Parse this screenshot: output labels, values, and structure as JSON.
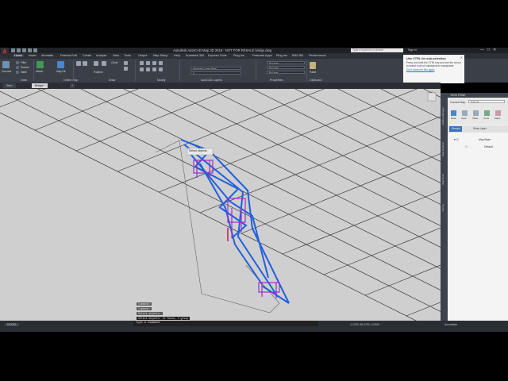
{
  "window": {
    "title": "Autodesk AutoCAD Map 3D 2016 - NOT FOR RESALE    bridge.dwg",
    "search_placeholder": "Type a keyword or phrase",
    "sign_in": "Sign In",
    "controls": [
      "—",
      "□",
      "✕"
    ]
  },
  "menu_tabs": [
    "Home",
    "Insert",
    "Annotate",
    "Feature Edit",
    "Create",
    "Analyze",
    "View",
    "Tools",
    "Output",
    "Map Setup",
    "Help",
    "Autodesk 360",
    "Express Tools",
    "Plug-ins",
    "Featured Apps",
    "Plug-ins",
    "BIM 360",
    "Performance"
  ],
  "ribbon": {
    "panels": [
      "Data",
      "Online Map",
      "Draw",
      "Modify",
      "AutoCAD Layers",
      "Properties",
      "Clipboard"
    ],
    "buttons": {
      "connect": "Connect",
      "filter": "Filter",
      "search": "Search",
      "table": "Table",
      "attach": "Attach",
      "map_dif": "Map Dif",
      "polyline": "Polyline",
      "circle": "Circle",
      "layer_state": "Unsaved Layer State",
      "layer_current": "0",
      "bylayer": [
        "ByLayer",
        "ByLayer",
        "ByLayer"
      ],
      "paste": "Paste"
    }
  },
  "tooltip": {
    "title": "Use CTRL for sub-selection",
    "body": "Press and hold the CTRL key and use the cursor to select a set of subobjects to manipulate.",
    "link": "Don't show me this again",
    "close": "✕"
  },
  "doc_tabs": [
    "Start",
    "Bridge*"
  ],
  "command": {
    "history": [
      "Command:",
      "Command:",
      "Select objects:",
      "Select objects: 12 found, 1 group"
    ],
    "input": "Type a command",
    "cursor_tip": "Select objects:"
  },
  "taskpane": {
    "header": "TASK PANE",
    "current_map_label": "Current Map:",
    "current_map": "Default",
    "tools": [
      "Data",
      "Style",
      "Table",
      "Tools",
      "Maps"
    ],
    "groups_label": "Groups",
    "view_label": "Show Layer",
    "rail_tabs": [
      "Display Manager",
      "Map Explorer",
      "Map Book",
      "Survey"
    ],
    "tree": [
      "Map Base",
      "Default"
    ]
  },
  "statusbar": {
    "coords": "-1.1203, 56.0750, 0.0000",
    "model": "MODEL",
    "scale": "Annotative"
  },
  "colors": {
    "viewport_bg": "#cfcfcf",
    "mesh": "#2a2a2a",
    "bridge": "#1f5fe0",
    "pier": "#9b30c8"
  }
}
